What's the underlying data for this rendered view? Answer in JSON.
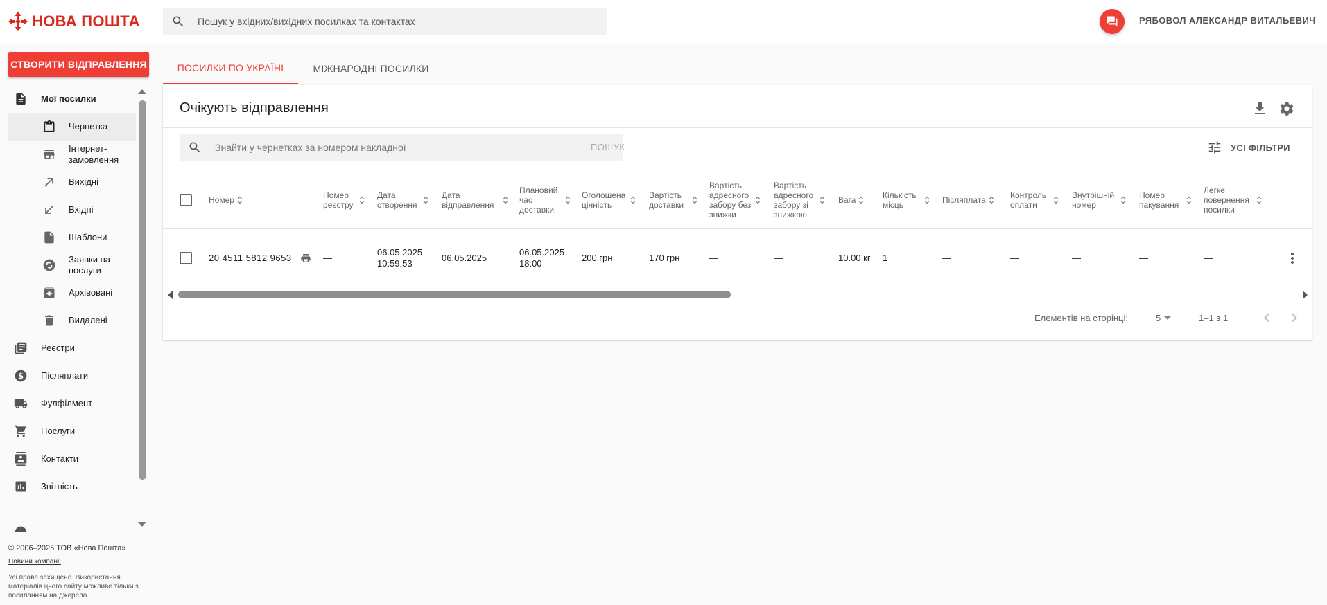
{
  "header": {
    "brand": "НОВА ПОШТА",
    "search_placeholder": "Пошук у вхідних/вихідних посилках та контактах",
    "user_name": "РЯБОВОЛ АЛЕКСАНДР ВИТАЛЬЕВИЧ",
    "brand_color": "#da291c",
    "accent_color": "#ef3e36"
  },
  "sidebar": {
    "create_button": "СТВОРИТИ ВІДПРАВЛЕННЯ",
    "items": [
      {
        "label": "Мої посилки",
        "icon": "document-icon",
        "level": "top",
        "bold": true
      },
      {
        "label": "Чернетка",
        "icon": "clipboard-icon",
        "level": "sub",
        "active": true
      },
      {
        "label": "Інтернет-замовлення",
        "icon": "store-icon",
        "level": "sub"
      },
      {
        "label": "Вихідні",
        "icon": "arrow-outgoing-icon",
        "level": "sub"
      },
      {
        "label": "Вхідні",
        "icon": "arrow-incoming-icon",
        "level": "sub"
      },
      {
        "label": "Шаблони",
        "icon": "template-icon",
        "level": "sub"
      },
      {
        "label": "Заявки на послуги",
        "icon": "service-request-icon",
        "level": "sub"
      },
      {
        "label": "Архівовані",
        "icon": "archive-icon",
        "level": "sub"
      },
      {
        "label": "Видалені",
        "icon": "trash-icon",
        "level": "sub"
      },
      {
        "label": "Реєстри",
        "icon": "registry-icon",
        "level": "top"
      },
      {
        "label": "Післяплати",
        "icon": "dollar-icon",
        "level": "top"
      },
      {
        "label": "Фулфілмент",
        "icon": "truck-icon",
        "level": "top"
      },
      {
        "label": "Послуги",
        "icon": "cart-icon",
        "level": "top"
      },
      {
        "label": "Контакти",
        "icon": "contacts-icon",
        "level": "top"
      },
      {
        "label": "Звітність",
        "icon": "chart-icon",
        "level": "top"
      }
    ],
    "footer_copyright": "© 2006–2025 ТОВ «Нова Пошта»",
    "footer_news": "Новини компанії",
    "footer_rights": "Усі права захищено. Використання матеріалів цього сайту можливе тільки з посиланням на джерело."
  },
  "tabs": [
    {
      "label": "ПОСИЛКИ ПО УКРАЇНІ",
      "active": true
    },
    {
      "label": "МІЖНАРОДНІ ПОСИЛКИ",
      "active": false
    }
  ],
  "card": {
    "title": "Очікують відправлення",
    "search_placeholder": "Знайти у чернетках за номером накладної",
    "search_button": "ПОШУК",
    "filters_label": "УСІ ФІЛЬТРИ"
  },
  "table": {
    "columns": [
      "Номер",
      "Номер реєстру",
      "Дата створення",
      "Дата відправлення",
      "Плановий час доставки",
      "Оголошена цінність",
      "Вартість доставки",
      "Вартість адресного забору без знижки",
      "Вартість адресного забору зі знижкою",
      "Вага",
      "Кількість місць",
      "Післяплата",
      "Контроль оплати",
      "Внутрішній номер",
      "Номер пакування",
      "Легке повернення посилки"
    ],
    "rows": [
      {
        "number": "20 4511 5812 9653",
        "registry": "—",
        "created": "06.05.2025 10:59:53",
        "sent": "06.05.2025",
        "planned": "06.05.2025 18:00",
        "declared_value": "200 грн",
        "delivery_cost": "170 грн",
        "pickup_no_discount": "—",
        "pickup_discount": "—",
        "weight": "10.00 кг",
        "places": "1",
        "cod": "—",
        "payment_control": "—",
        "internal_number": "—",
        "package_number": "—",
        "easy_return": "—"
      }
    ]
  },
  "pagination": {
    "per_page_label": "Елементів на сторінці:",
    "per_page": "5",
    "range": "1–1 з 1"
  }
}
